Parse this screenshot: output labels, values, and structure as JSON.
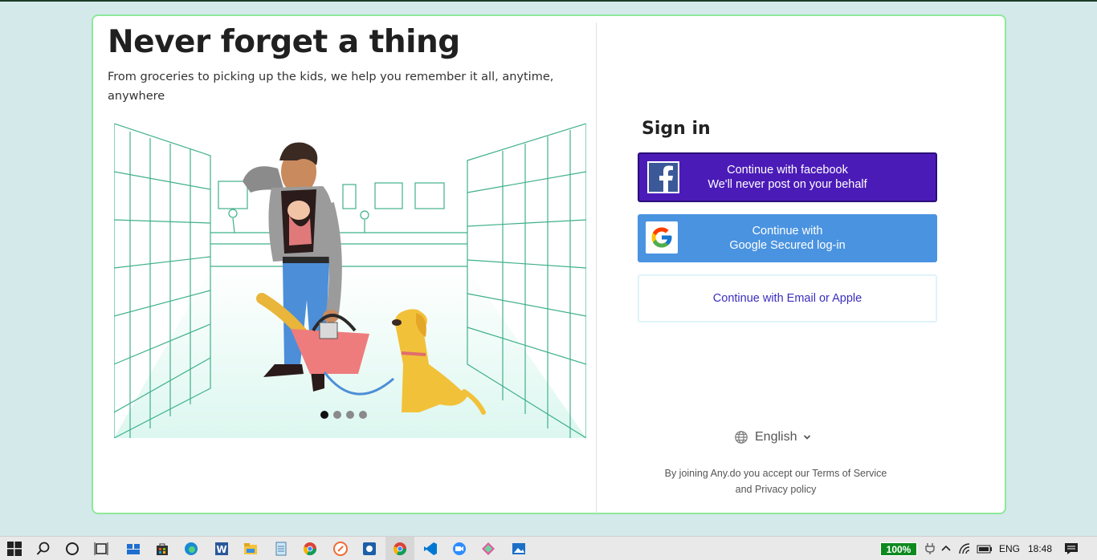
{
  "hero": {
    "headline": "Never forget a thing",
    "subtext": "From groceries to picking up the kids, we help you remember it all, anytime, anywhere",
    "carousel_total": 4,
    "carousel_active": 1
  },
  "signin": {
    "title": "Sign in",
    "facebook_line1": "Continue with facebook",
    "facebook_line2": "We'll never post on your behalf",
    "google_line1": "Continue with",
    "google_line2": "Google Secured log-in",
    "email_label": "Continue with Email or Apple"
  },
  "language": {
    "label": "English",
    "icon": "globe-icon"
  },
  "legal": {
    "line1": "By joining Any.do you accept our Terms of Service",
    "line2": "and Privacy policy"
  },
  "taskbar": {
    "battery": "100%",
    "lang": "ENG",
    "time": "18:48"
  },
  "colors": {
    "facebook": "#4b1bb8",
    "google": "#4a93e0",
    "card_border": "#8ee89a",
    "page_bg": "#d3e9ea"
  }
}
